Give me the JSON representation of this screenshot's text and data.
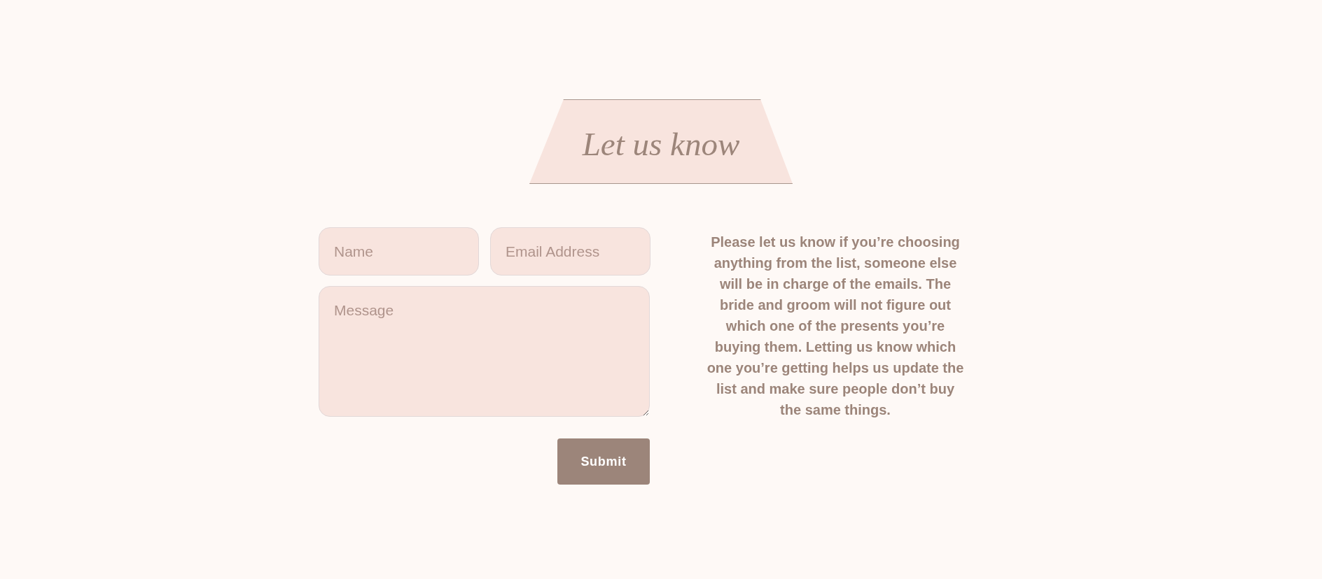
{
  "header": {
    "title": "Let us know"
  },
  "form": {
    "name_field": {
      "placeholder": "Name"
    },
    "email_field": {
      "placeholder": "Email Address"
    },
    "message_field": {
      "placeholder": "Message"
    },
    "submit_button": {
      "label": "Submit"
    }
  },
  "info": {
    "lines": [
      "Please let us know if you’re choosing",
      "anything from the list, someone else",
      "will be in charge of the emails. The",
      "bride and groom will not figure out",
      "which one of the presents you’re",
      "buying them. Letting us know which",
      "one you’re getting helps us update the",
      "list and make sure people don’t buy",
      "the same things."
    ]
  }
}
